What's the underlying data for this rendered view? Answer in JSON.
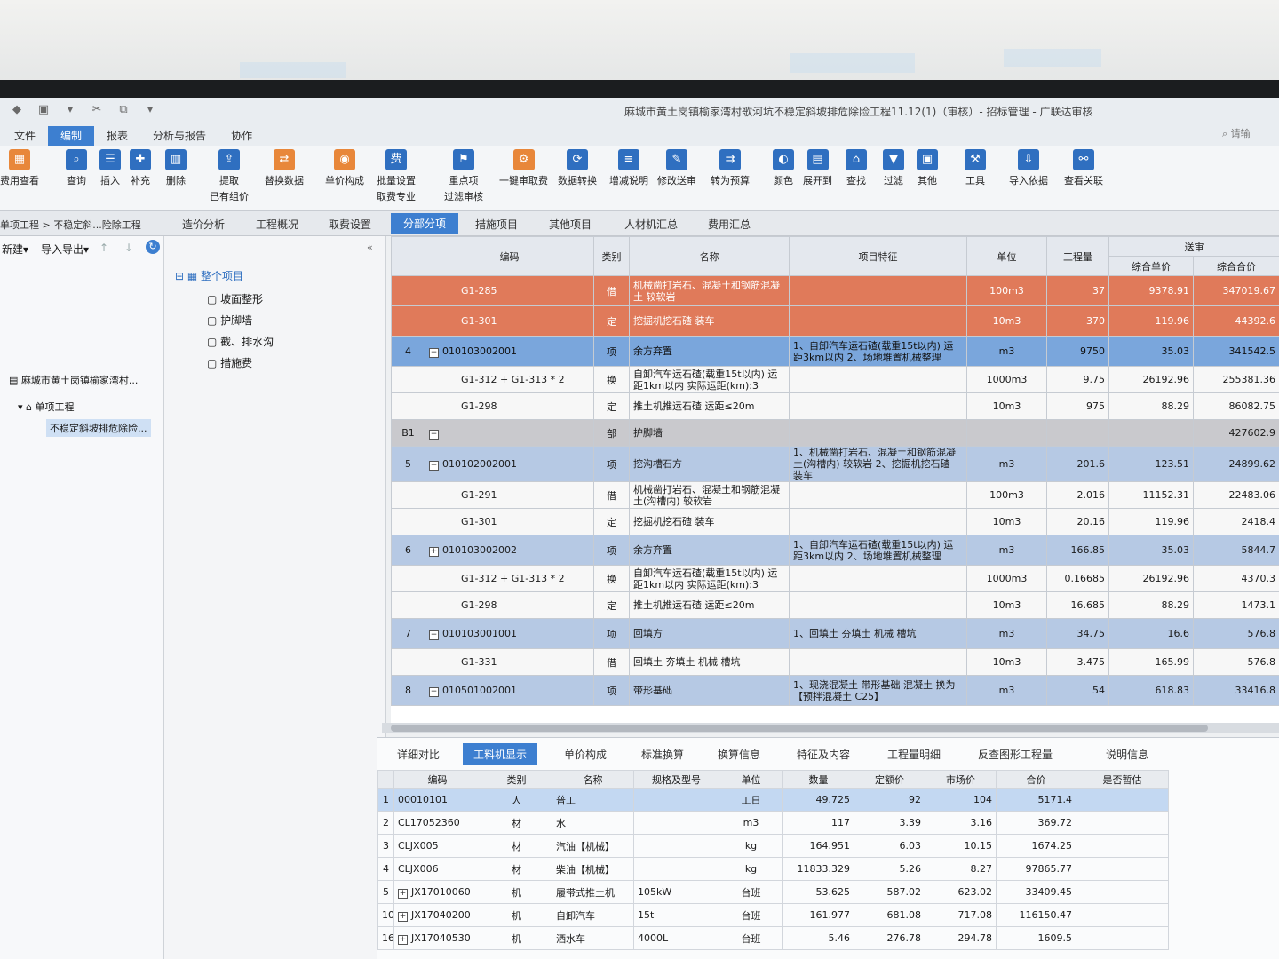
{
  "app": {
    "title": "麻城市黄土岗镇榆家湾村歌河坑不稳定斜坡排危除险工程11.12(1)（审核）- 招标管理 - 广联达审核",
    "search_placeholder": "请输"
  },
  "menu": [
    "文件",
    "编制",
    "报表",
    "分析与报告",
    "协作"
  ],
  "ribbon": [
    {
      "label": "费用查看",
      "color": "#e8873a",
      "icon": "▦"
    },
    {
      "label": "查询",
      "color": "#2f6fc0",
      "icon": "⌕"
    },
    {
      "label": "插入",
      "color": "#2f6fc0",
      "icon": "☰"
    },
    {
      "label": "补充",
      "color": "#2f6fc0",
      "icon": "✚"
    },
    {
      "label": "删除",
      "color": "#2f6fc0",
      "icon": "▥"
    },
    {
      "label": "提取",
      "label2": "已有组价",
      "color": "#2f6fc0",
      "icon": "⇪"
    },
    {
      "label": "替换数据",
      "color": "#e8873a",
      "icon": "⇄"
    },
    {
      "label": "单价构成",
      "color": "#e8873a",
      "icon": "◉"
    },
    {
      "label": "批量设置",
      "label2": "取费专业",
      "color": "#2f6fc0",
      "icon": "费"
    },
    {
      "label": "重点项",
      "label2": "过滤审核",
      "color": "#2f6fc0",
      "icon": "⚑"
    },
    {
      "label": "一键审取费",
      "color": "#e8873a",
      "icon": "⚙"
    },
    {
      "label": "数据转换",
      "color": "#2f6fc0",
      "icon": "⟳"
    },
    {
      "label": "增减说明",
      "color": "#2f6fc0",
      "icon": "≡"
    },
    {
      "label": "修改送审",
      "color": "#2f6fc0",
      "icon": "✎"
    },
    {
      "label": "转为预算",
      "color": "#2f6fc0",
      "icon": "⇉"
    },
    {
      "label": "颜色",
      "color": "#2f6fc0",
      "icon": "◐"
    },
    {
      "label": "展开到",
      "color": "#2f6fc0",
      "icon": "▤"
    },
    {
      "label": "查找",
      "color": "#2f6fc0",
      "icon": "⌂"
    },
    {
      "label": "过滤",
      "color": "#2f6fc0",
      "icon": "▼"
    },
    {
      "label": "其他",
      "color": "#2f6fc0",
      "icon": "▣"
    },
    {
      "label": "工具",
      "color": "#2f6fc0",
      "icon": "⚒"
    },
    {
      "label": "导入依据",
      "color": "#2f6fc0",
      "icon": "⇩"
    },
    {
      "label": "查看关联",
      "color": "#2f6fc0",
      "icon": "⚯"
    }
  ],
  "breadcrumb": "单项工程 > 不稳定斜...险除工程",
  "view_tabs": [
    "造价分析",
    "工程概况",
    "取费设置",
    "分部分项",
    "措施项目",
    "其他项目",
    "人材机汇总",
    "费用汇总"
  ],
  "left_tree": {
    "toolbar_new": "新建",
    "toolbar_import": "导入导出",
    "root": "麻城市黄土岗镇榆家湾村...",
    "single": "单项工程",
    "unit": "不稳定斜坡排危除险..."
  },
  "mid_tree": [
    "整个项目",
    "坡面整形",
    "护脚墙",
    "截、排水沟",
    "措施费"
  ],
  "grid": {
    "headers": {
      "code": "编码",
      "type": "类别",
      "name": "名称",
      "feature": "项目特征",
      "unit": "单位",
      "qty": "工程量",
      "group": "送审",
      "uprice": "综合单价",
      "total": "综合合价"
    },
    "rows": [
      {
        "style": "red",
        "no": "",
        "code": "G1-285",
        "type": "借",
        "name": "机械凿打岩石、混凝土和钢筋混凝土 较软岩",
        "feature": "",
        "unit": "100m3",
        "qty": "37",
        "uprice": "9378.91",
        "total": "347019.67"
      },
      {
        "style": "red",
        "no": "",
        "code": "G1-301",
        "type": "定",
        "name": "挖掘机挖石碴 装车",
        "feature": "",
        "unit": "10m3",
        "qty": "370",
        "uprice": "119.96",
        "total": "44392.6"
      },
      {
        "style": "sel",
        "no": "4",
        "code": "010103002001",
        "exp": "−",
        "type": "项",
        "name": "余方弃置",
        "feature": "1、自卸汽车运石碴(载重15t以内) 运距3km以内 2、场地堆置机械整理",
        "unit": "m3",
        "qty": "9750",
        "uprice": "35.03",
        "total": "341542.5"
      },
      {
        "style": "plain",
        "no": "",
        "code": "G1-312 + G1-313 * 2",
        "type": "换",
        "name": "自卸汽车运石碴(载重15t以内) 运距1km以内 实际运距(km):3",
        "feature": "",
        "unit": "1000m3",
        "qty": "9.75",
        "uprice": "26192.96",
        "total": "255381.36"
      },
      {
        "style": "plain",
        "no": "",
        "code": "G1-298",
        "type": "定",
        "name": "推土机推运石碴 运距≤20m",
        "feature": "",
        "unit": "10m3",
        "qty": "975",
        "uprice": "88.29",
        "total": "86082.75"
      },
      {
        "style": "dept",
        "no": "B1",
        "code": "",
        "exp": "−",
        "type": "部",
        "name": "护脚墙",
        "feature": "",
        "unit": "",
        "qty": "",
        "uprice": "",
        "total": "427602.9"
      },
      {
        "style": "blue",
        "no": "5",
        "code": "010102002001",
        "exp": "−",
        "type": "项",
        "name": "挖沟槽石方",
        "feature": "1、机械凿打岩石、混凝土和钢筋混凝土(沟槽内) 较软岩 2、挖掘机挖石碴 装车",
        "unit": "m3",
        "qty": "201.6",
        "uprice": "123.51",
        "total": "24899.62"
      },
      {
        "style": "plain",
        "no": "",
        "code": "G1-291",
        "type": "借",
        "name": "机械凿打岩石、混凝土和钢筋混凝土(沟槽内) 较软岩",
        "feature": "",
        "unit": "100m3",
        "qty": "2.016",
        "uprice": "11152.31",
        "total": "22483.06"
      },
      {
        "style": "plain",
        "no": "",
        "code": "G1-301",
        "type": "定",
        "name": "挖掘机挖石碴 装车",
        "feature": "",
        "unit": "10m3",
        "qty": "20.16",
        "uprice": "119.96",
        "total": "2418.4"
      },
      {
        "style": "blue",
        "no": "6",
        "code": "010103002002",
        "exp": "+",
        "type": "项",
        "name": "余方弃置",
        "feature": "1、自卸汽车运石碴(载重15t以内) 运距3km以内 2、场地堆置机械整理",
        "unit": "m3",
        "qty": "166.85",
        "uprice": "35.03",
        "total": "5844.7"
      },
      {
        "style": "plain",
        "no": "",
        "code": "G1-312 + G1-313 * 2",
        "type": "换",
        "name": "自卸汽车运石碴(载重15t以内) 运距1km以内 实际运距(km):3",
        "feature": "",
        "unit": "1000m3",
        "qty": "0.16685",
        "uprice": "26192.96",
        "total": "4370.3"
      },
      {
        "style": "plain",
        "no": "",
        "code": "G1-298",
        "type": "定",
        "name": "推土机推运石碴 运距≤20m",
        "feature": "",
        "unit": "10m3",
        "qty": "16.685",
        "uprice": "88.29",
        "total": "1473.1"
      },
      {
        "style": "blue",
        "no": "7",
        "code": "010103001001",
        "exp": "−",
        "type": "项",
        "name": "回填方",
        "feature": "1、回填土 夯填土 机械 槽坑",
        "unit": "m3",
        "qty": "34.75",
        "uprice": "16.6",
        "total": "576.8"
      },
      {
        "style": "plain",
        "no": "",
        "code": "G1-331",
        "type": "借",
        "name": "回填土 夯填土 机械 槽坑",
        "feature": "",
        "unit": "10m3",
        "qty": "3.475",
        "uprice": "165.99",
        "total": "576.8"
      },
      {
        "style": "blue",
        "no": "8",
        "code": "010501002001",
        "exp": "−",
        "type": "项",
        "name": "带形基础",
        "feature": "1、现浇混凝土 带形基础 混凝土 换为【预拌混凝土 C25】",
        "unit": "m3",
        "qty": "54",
        "uprice": "618.83",
        "total": "33416.8"
      }
    ]
  },
  "bottom": {
    "tabs": [
      "详细对比",
      "工料机显示",
      "单价构成",
      "标准换算",
      "换算信息",
      "特征及内容",
      "工程量明细",
      "反查图形工程量",
      "说明信息"
    ],
    "headers": {
      "code": "编码",
      "type": "类别",
      "name": "名称",
      "spec": "规格及型号",
      "unit": "单位",
      "qty": "数量",
      "quota": "定额价",
      "market": "市场价",
      "total": "合价",
      "est": "是否暂估"
    },
    "rows": [
      {
        "no": "1",
        "code": "00010101",
        "exp": "",
        "type": "人",
        "name": "普工",
        "spec": "",
        "unit": "工日",
        "qty": "49.725",
        "quota": "92",
        "market": "104",
        "total": "5171.4",
        "sel": true
      },
      {
        "no": "2",
        "code": "CL17052360",
        "exp": "",
        "type": "材",
        "name": "水",
        "spec": "",
        "unit": "m3",
        "qty": "117",
        "quota": "3.39",
        "market": "3.16",
        "total": "369.72"
      },
      {
        "no": "3",
        "code": "CLJX005",
        "exp": "",
        "type": "材",
        "name": "汽油【机械】",
        "spec": "",
        "unit": "kg",
        "qty": "164.951",
        "quota": "6.03",
        "market": "10.15",
        "total": "1674.25"
      },
      {
        "no": "4",
        "code": "CLJX006",
        "exp": "",
        "type": "材",
        "name": "柴油【机械】",
        "spec": "",
        "unit": "kg",
        "qty": "11833.329",
        "quota": "5.26",
        "market": "8.27",
        "total": "97865.77"
      },
      {
        "no": "5",
        "code": "JX17010060",
        "exp": "+",
        "type": "机",
        "name": "履带式推土机",
        "spec": "105kW",
        "unit": "台班",
        "qty": "53.625",
        "quota": "587.02",
        "market": "623.02",
        "total": "33409.45"
      },
      {
        "no": "10",
        "code": "JX17040200",
        "exp": "+",
        "type": "机",
        "name": "自卸汽车",
        "spec": "15t",
        "unit": "台班",
        "qty": "161.977",
        "quota": "681.08",
        "market": "717.08",
        "total": "116150.47"
      },
      {
        "no": "16",
        "code": "JX17040530",
        "exp": "+",
        "type": "机",
        "name": "洒水车",
        "spec": "4000L",
        "unit": "台班",
        "qty": "5.46",
        "quota": "276.78",
        "market": "294.78",
        "total": "1609.5"
      }
    ]
  }
}
